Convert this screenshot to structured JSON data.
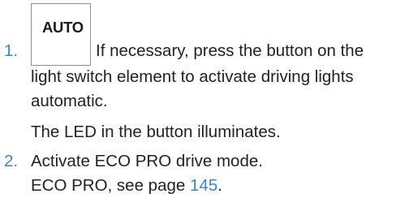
{
  "steps": [
    {
      "number": "1.",
      "button_label": "AUTO",
      "text_line1": "If necessary, press the button on the",
      "text_line2": "light switch element to activate driving lights",
      "text_line3": "automatic.",
      "note": "The LED in the button illuminates."
    },
    {
      "number": "2.",
      "text": "Activate ECO PRO drive mode.",
      "ref_prefix": "ECO PRO, see page ",
      "ref_page": "145",
      "ref_suffix": "."
    }
  ],
  "colors": {
    "accent": "#3b86c6",
    "text": "#222222",
    "button_border": "#8f8f8f"
  }
}
